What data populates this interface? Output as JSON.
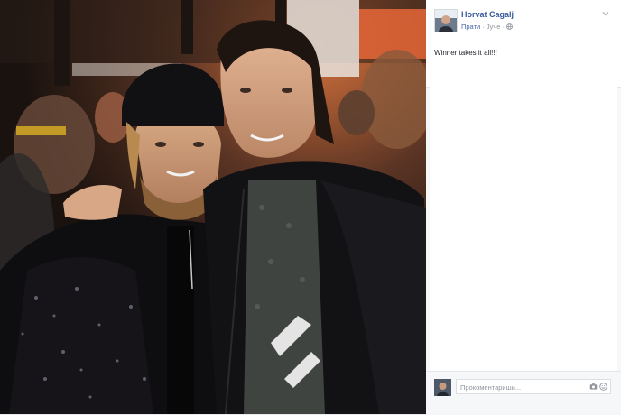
{
  "post": {
    "author": "Horvat Cagalj",
    "follow_label": "Прати",
    "separator": "·",
    "time": "Јуче",
    "text": "Winner takes it all!!!"
  },
  "comment": {
    "placeholder": "Прокоментариши..."
  },
  "icons": {
    "menu": "chevron-down-icon",
    "audience": "globe-icon",
    "camera": "camera-icon",
    "emoji": "smiley-icon"
  },
  "colors": {
    "link": "#365899",
    "meta": "#90949c",
    "text": "#1d2129",
    "panel": "#f6f7f9"
  }
}
